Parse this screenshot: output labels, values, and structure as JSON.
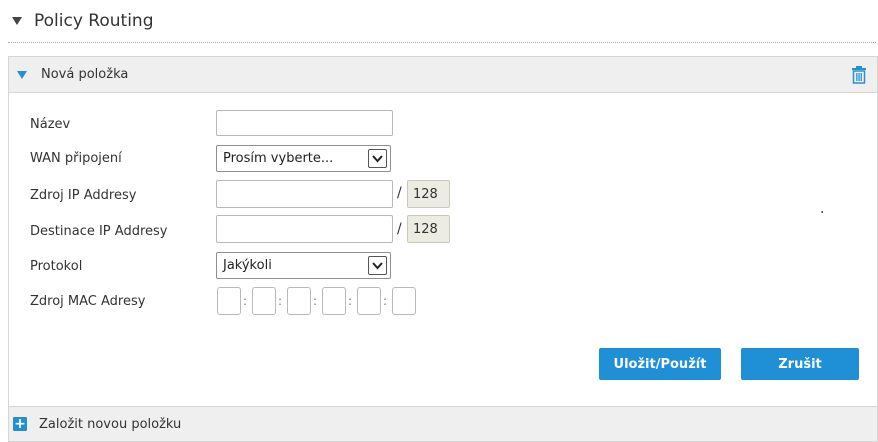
{
  "section": {
    "title": "Policy Routing"
  },
  "entry": {
    "title": "Nová položka",
    "fields": {
      "name_label": "Název",
      "wan_label": "WAN připojení",
      "wan_selected": "Prosím vyberte...",
      "src_ip_label": "Zdroj IP Addresy",
      "src_prefix": "128",
      "dst_ip_label": "Destinace IP Addresy",
      "dst_prefix": "128",
      "protocol_label": "Protokol",
      "protocol_selected": "Jakýkoli",
      "mac_label": "Zdroj MAC Adresy"
    },
    "slash": "/",
    "colon": ":",
    "stray_dot": ".",
    "buttons": {
      "save": "Uložit/Použít",
      "cancel": "Zrušit"
    }
  },
  "footer": {
    "add_label": "Založit novou položku"
  },
  "colors": {
    "accent": "#1f8fd6",
    "panel_header_bg": "#efefef"
  }
}
